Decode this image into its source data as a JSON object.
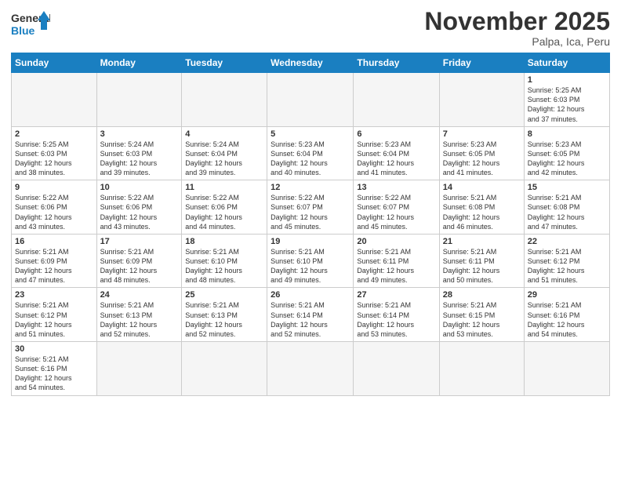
{
  "logo": {
    "text_general": "General",
    "text_blue": "Blue"
  },
  "title": "November 2025",
  "subtitle": "Palpa, Ica, Peru",
  "weekdays": [
    "Sunday",
    "Monday",
    "Tuesday",
    "Wednesday",
    "Thursday",
    "Friday",
    "Saturday"
  ],
  "weeks": [
    [
      {
        "day": "",
        "info": ""
      },
      {
        "day": "",
        "info": ""
      },
      {
        "day": "",
        "info": ""
      },
      {
        "day": "",
        "info": ""
      },
      {
        "day": "",
        "info": ""
      },
      {
        "day": "",
        "info": ""
      },
      {
        "day": "1",
        "info": "Sunrise: 5:25 AM\nSunset: 6:03 PM\nDaylight: 12 hours\nand 37 minutes."
      }
    ],
    [
      {
        "day": "2",
        "info": "Sunrise: 5:25 AM\nSunset: 6:03 PM\nDaylight: 12 hours\nand 38 minutes."
      },
      {
        "day": "3",
        "info": "Sunrise: 5:24 AM\nSunset: 6:03 PM\nDaylight: 12 hours\nand 39 minutes."
      },
      {
        "day": "4",
        "info": "Sunrise: 5:24 AM\nSunset: 6:04 PM\nDaylight: 12 hours\nand 39 minutes."
      },
      {
        "day": "5",
        "info": "Sunrise: 5:23 AM\nSunset: 6:04 PM\nDaylight: 12 hours\nand 40 minutes."
      },
      {
        "day": "6",
        "info": "Sunrise: 5:23 AM\nSunset: 6:04 PM\nDaylight: 12 hours\nand 41 minutes."
      },
      {
        "day": "7",
        "info": "Sunrise: 5:23 AM\nSunset: 6:05 PM\nDaylight: 12 hours\nand 41 minutes."
      },
      {
        "day": "8",
        "info": "Sunrise: 5:23 AM\nSunset: 6:05 PM\nDaylight: 12 hours\nand 42 minutes."
      }
    ],
    [
      {
        "day": "9",
        "info": "Sunrise: 5:22 AM\nSunset: 6:06 PM\nDaylight: 12 hours\nand 43 minutes."
      },
      {
        "day": "10",
        "info": "Sunrise: 5:22 AM\nSunset: 6:06 PM\nDaylight: 12 hours\nand 43 minutes."
      },
      {
        "day": "11",
        "info": "Sunrise: 5:22 AM\nSunset: 6:06 PM\nDaylight: 12 hours\nand 44 minutes."
      },
      {
        "day": "12",
        "info": "Sunrise: 5:22 AM\nSunset: 6:07 PM\nDaylight: 12 hours\nand 45 minutes."
      },
      {
        "day": "13",
        "info": "Sunrise: 5:22 AM\nSunset: 6:07 PM\nDaylight: 12 hours\nand 45 minutes."
      },
      {
        "day": "14",
        "info": "Sunrise: 5:21 AM\nSunset: 6:08 PM\nDaylight: 12 hours\nand 46 minutes."
      },
      {
        "day": "15",
        "info": "Sunrise: 5:21 AM\nSunset: 6:08 PM\nDaylight: 12 hours\nand 47 minutes."
      }
    ],
    [
      {
        "day": "16",
        "info": "Sunrise: 5:21 AM\nSunset: 6:09 PM\nDaylight: 12 hours\nand 47 minutes."
      },
      {
        "day": "17",
        "info": "Sunrise: 5:21 AM\nSunset: 6:09 PM\nDaylight: 12 hours\nand 48 minutes."
      },
      {
        "day": "18",
        "info": "Sunrise: 5:21 AM\nSunset: 6:10 PM\nDaylight: 12 hours\nand 48 minutes."
      },
      {
        "day": "19",
        "info": "Sunrise: 5:21 AM\nSunset: 6:10 PM\nDaylight: 12 hours\nand 49 minutes."
      },
      {
        "day": "20",
        "info": "Sunrise: 5:21 AM\nSunset: 6:11 PM\nDaylight: 12 hours\nand 49 minutes."
      },
      {
        "day": "21",
        "info": "Sunrise: 5:21 AM\nSunset: 6:11 PM\nDaylight: 12 hours\nand 50 minutes."
      },
      {
        "day": "22",
        "info": "Sunrise: 5:21 AM\nSunset: 6:12 PM\nDaylight: 12 hours\nand 51 minutes."
      }
    ],
    [
      {
        "day": "23",
        "info": "Sunrise: 5:21 AM\nSunset: 6:12 PM\nDaylight: 12 hours\nand 51 minutes."
      },
      {
        "day": "24",
        "info": "Sunrise: 5:21 AM\nSunset: 6:13 PM\nDaylight: 12 hours\nand 52 minutes."
      },
      {
        "day": "25",
        "info": "Sunrise: 5:21 AM\nSunset: 6:13 PM\nDaylight: 12 hours\nand 52 minutes."
      },
      {
        "day": "26",
        "info": "Sunrise: 5:21 AM\nSunset: 6:14 PM\nDaylight: 12 hours\nand 52 minutes."
      },
      {
        "day": "27",
        "info": "Sunrise: 5:21 AM\nSunset: 6:14 PM\nDaylight: 12 hours\nand 53 minutes."
      },
      {
        "day": "28",
        "info": "Sunrise: 5:21 AM\nSunset: 6:15 PM\nDaylight: 12 hours\nand 53 minutes."
      },
      {
        "day": "29",
        "info": "Sunrise: 5:21 AM\nSunset: 6:16 PM\nDaylight: 12 hours\nand 54 minutes."
      }
    ],
    [
      {
        "day": "30",
        "info": "Sunrise: 5:21 AM\nSunset: 6:16 PM\nDaylight: 12 hours\nand 54 minutes."
      },
      {
        "day": "",
        "info": ""
      },
      {
        "day": "",
        "info": ""
      },
      {
        "day": "",
        "info": ""
      },
      {
        "day": "",
        "info": ""
      },
      {
        "day": "",
        "info": ""
      },
      {
        "day": "",
        "info": ""
      }
    ]
  ]
}
